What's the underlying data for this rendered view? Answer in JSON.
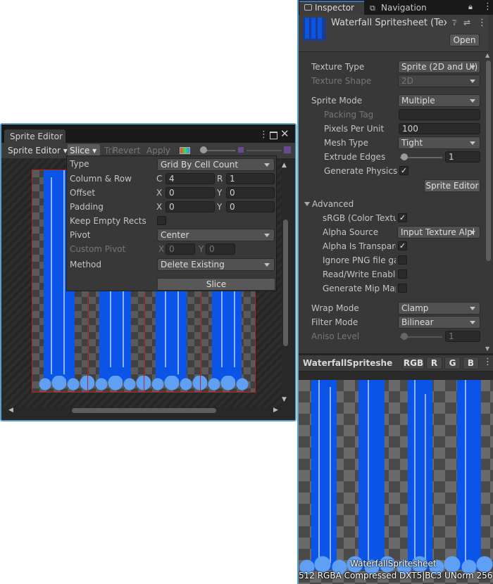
{
  "sprite_editor": {
    "window_title": "Sprite Editor",
    "menu_label": "Sprite Editor",
    "slice_label": "Slice",
    "trim_label": "Tri",
    "revert_label": "Revert",
    "apply_label": "Apply"
  },
  "slice_popup": {
    "type_label": "Type",
    "type_value": "Grid By Cell Count",
    "column_row_label": "Column & Row",
    "c_label": "C",
    "c_value": "4",
    "r_label": "R",
    "r_value": "1",
    "offset_label": "Offset",
    "offset_x": "0",
    "offset_y": "0",
    "padding_label": "Padding",
    "padding_x": "0",
    "padding_y": "0",
    "x_label": "X",
    "y_label": "Y",
    "keep_empty_label": "Keep Empty Rects",
    "pivot_label": "Pivot",
    "pivot_value": "Center",
    "custom_pivot_label": "Custom Pivot",
    "custom_x": "0",
    "custom_y": "0",
    "method_label": "Method",
    "method_value": "Delete Existing",
    "slice_button": "Slice"
  },
  "inspector": {
    "tab_inspector": "Inspector",
    "tab_navigation": "Navigation",
    "asset_title": "Waterfall Spritesheet (Tex",
    "open_button": "Open",
    "texture_type_label": "Texture Type",
    "texture_type_value": "Sprite (2D and UI)",
    "texture_shape_label": "Texture Shape",
    "texture_shape_value": "2D",
    "sprite_mode_label": "Sprite Mode",
    "sprite_mode_value": "Multiple",
    "packing_tag_label": "Packing Tag",
    "ppu_label": "Pixels Per Unit",
    "ppu_value": "100",
    "mesh_type_label": "Mesh Type",
    "mesh_type_value": "Tight",
    "extrude_label": "Extrude Edges",
    "extrude_value": "1",
    "gen_physics_label": "Generate Physics S",
    "sprite_editor_button": "Sprite Editor",
    "advanced_label": "Advanced",
    "srgb_label": "sRGB (Color Textu",
    "alpha_source_label": "Alpha Source",
    "alpha_source_value": "Input Texture Alpl",
    "alpha_transparent_label": "Alpha Is Transpare",
    "ignore_png_label": "Ignore PNG file gar",
    "read_write_label": "Read/Write Enable",
    "mipmap_label": "Generate Mip Map",
    "wrap_mode_label": "Wrap Mode",
    "wrap_mode_value": "Clamp",
    "filter_mode_label": "Filter Mode",
    "filter_mode_value": "Bilinear",
    "aniso_label": "Aniso Level",
    "aniso_value": "1"
  },
  "preview": {
    "name": "WaterfallSpriteshe",
    "rgb": "RGB",
    "r": "R",
    "g": "G",
    "b": "B",
    "overlay_name": "WaterfallSpritesheet",
    "info": "512  RGBA Compressed DXT5|BC3 UNorm  256"
  },
  "colors": {
    "water": "#0a55e8",
    "panel": "#383838",
    "accent": "#3a72b0"
  }
}
